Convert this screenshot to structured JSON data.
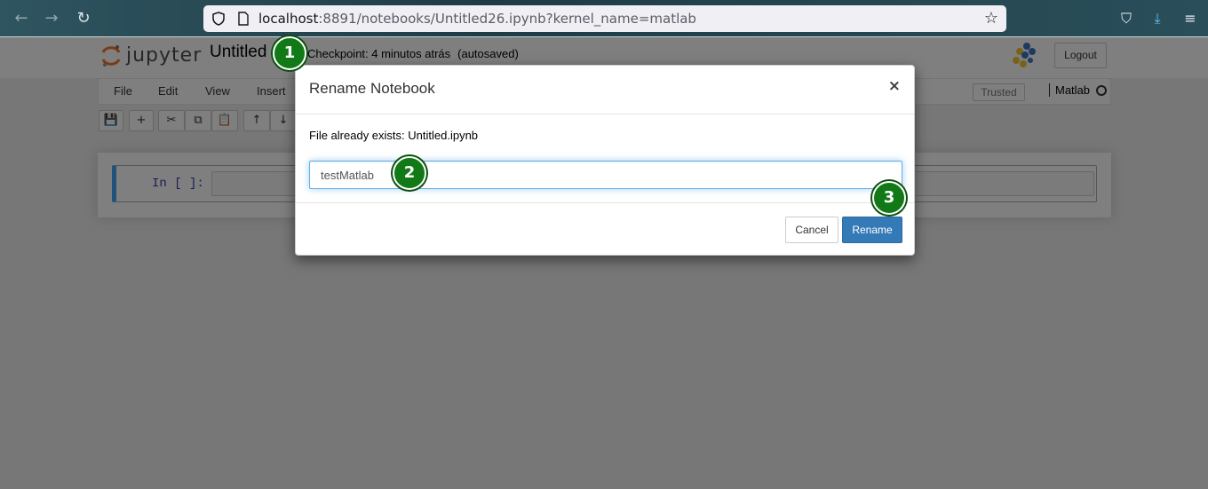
{
  "browser": {
    "url_host": "localhost",
    "url_rest": ":8891/notebooks/Untitled26.ipynb?kernel_name=matlab",
    "back_icon": "←",
    "forward_icon": "→",
    "reload_icon": "↻",
    "star_icon": "☆",
    "pocket_icon": "⛉",
    "download_icon": "⤓",
    "menu_icon": "≡"
  },
  "header": {
    "logo_text": "jupyter",
    "notebook_title": "Untitled",
    "checkpoint": "Checkpoint: 4 minutos atrás",
    "autosaved": "(autosaved)",
    "logout_label": "Logout"
  },
  "menubar": {
    "items": [
      "File",
      "Edit",
      "View",
      "Insert"
    ],
    "trusted_label": "Trusted",
    "kernel_name": "Matlab"
  },
  "toolbar": {
    "buttons": [
      "💾",
      "+",
      "✂",
      "⧉",
      "📋",
      "↑",
      "↓"
    ]
  },
  "cell": {
    "prompt": "In [ ]:"
  },
  "modal": {
    "title": "Rename Notebook",
    "close_label": "×",
    "message": "File already exists: Untitled.ipynb",
    "input_value": "testMatlab",
    "cancel_label": "Cancel",
    "rename_label": "Rename"
  },
  "badges": [
    "1",
    "2",
    "3"
  ],
  "colors": {
    "primary_button": "#337ab7",
    "badge_green": "#117a17",
    "input_focus": "#66afe9"
  }
}
